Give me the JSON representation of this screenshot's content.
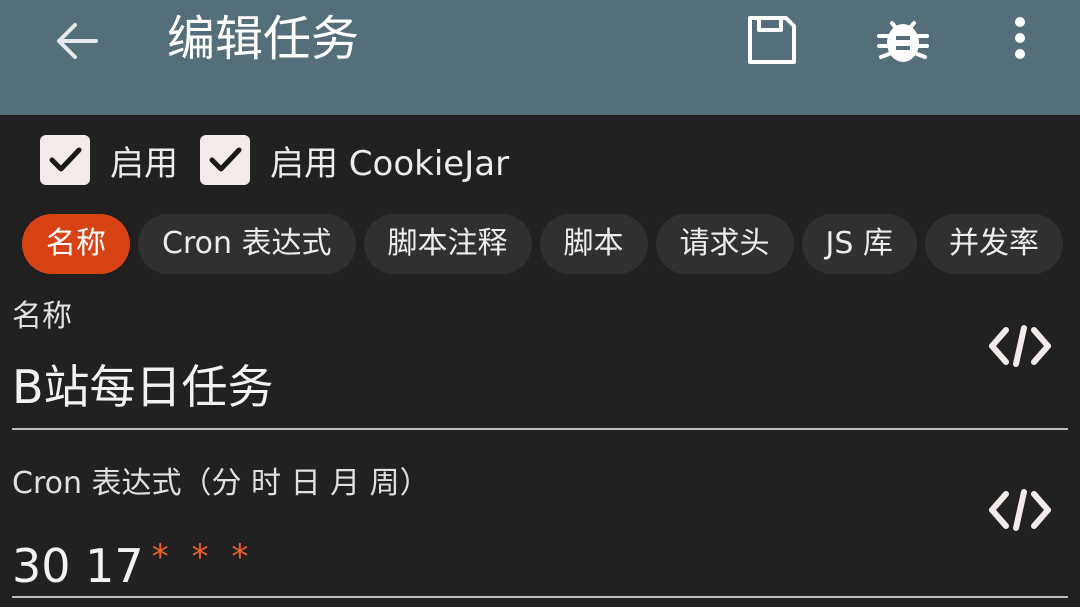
{
  "header": {
    "title": "编辑任务"
  },
  "toggles": [
    {
      "label": "启用",
      "checked": true
    },
    {
      "label": "启用 CookieJar",
      "checked": true
    }
  ],
  "tabs": [
    {
      "label": "名称",
      "active": true
    },
    {
      "label": "Cron 表达式",
      "active": false
    },
    {
      "label": "脚本注释",
      "active": false
    },
    {
      "label": "脚本",
      "active": false
    },
    {
      "label": "请求头",
      "active": false
    },
    {
      "label": "JS 库",
      "active": false
    },
    {
      "label": "并发率",
      "active": false
    }
  ],
  "fields": {
    "name": {
      "label": "名称",
      "value": "B站每日任务"
    },
    "cron": {
      "label": "Cron 表达式（分 时 日 月 周）",
      "value": "30 17",
      "wildcards": "* * *"
    }
  },
  "colors": {
    "appbar": "#546e7a",
    "background": "#212121",
    "accent": "#d84315",
    "wildcard": "#e8602c"
  },
  "icons": {
    "back": "arrow-left-icon",
    "save": "floppy-disk-icon",
    "debug": "bug-icon",
    "more": "more-vertical-icon",
    "code": "code-icon"
  }
}
